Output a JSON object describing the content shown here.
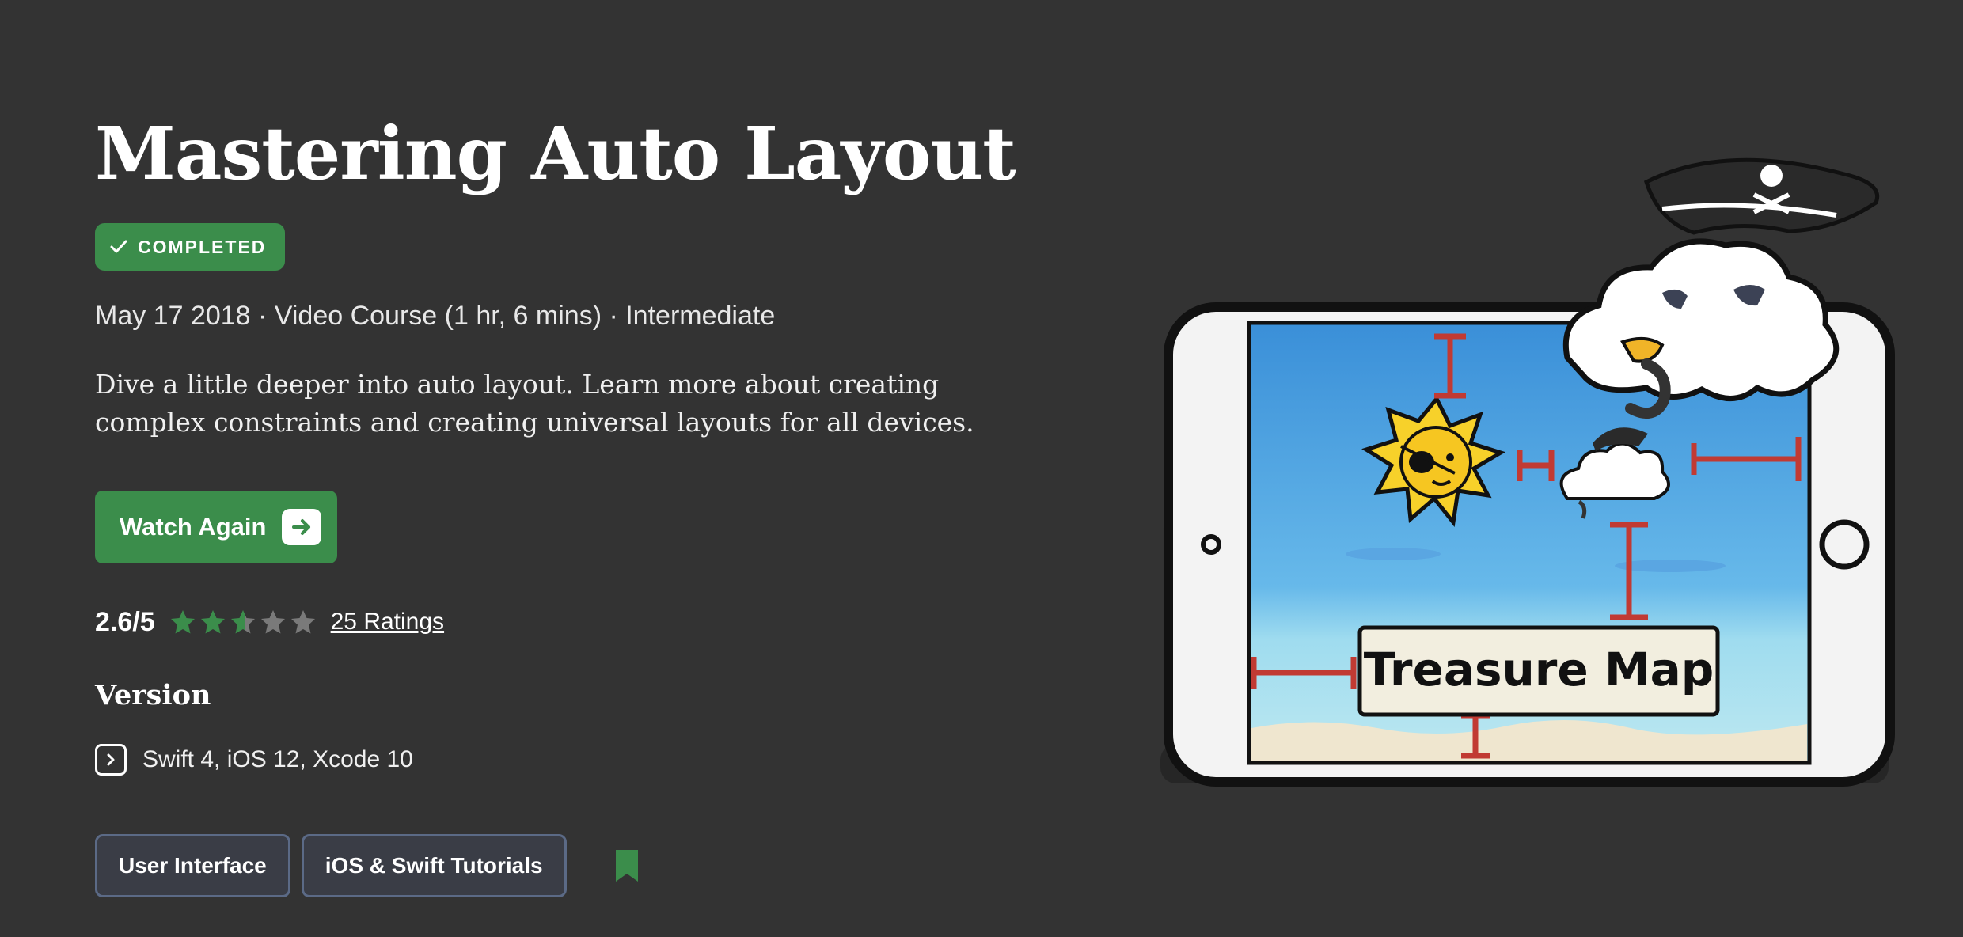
{
  "course": {
    "title": "Mastering Auto Layout",
    "status_badge": "COMPLETED",
    "meta": "May 17 2018 · Video Course (1 hr, 6 mins) · Intermediate",
    "description": "Dive a little deeper into auto layout. Learn more about creating complex constraints and creating universal layouts for all devices."
  },
  "actions": {
    "watch_label": "Watch Again"
  },
  "rating": {
    "score": "2.6/5",
    "value": 2.6,
    "max": 5,
    "count_label": "25 Ratings"
  },
  "version": {
    "heading": "Version",
    "text": "Swift 4, iOS 12, Xcode 10"
  },
  "tags": [
    "User Interface",
    "iOS & Swift Tutorials"
  ],
  "artwork": {
    "sign_text": "Treasure Map"
  },
  "colors": {
    "background": "#333333",
    "accent_green": "#3b8d4b",
    "star_filled": "#3b8d4b",
    "star_empty": "#7a7a7a",
    "tag_border": "#5b6a86"
  }
}
